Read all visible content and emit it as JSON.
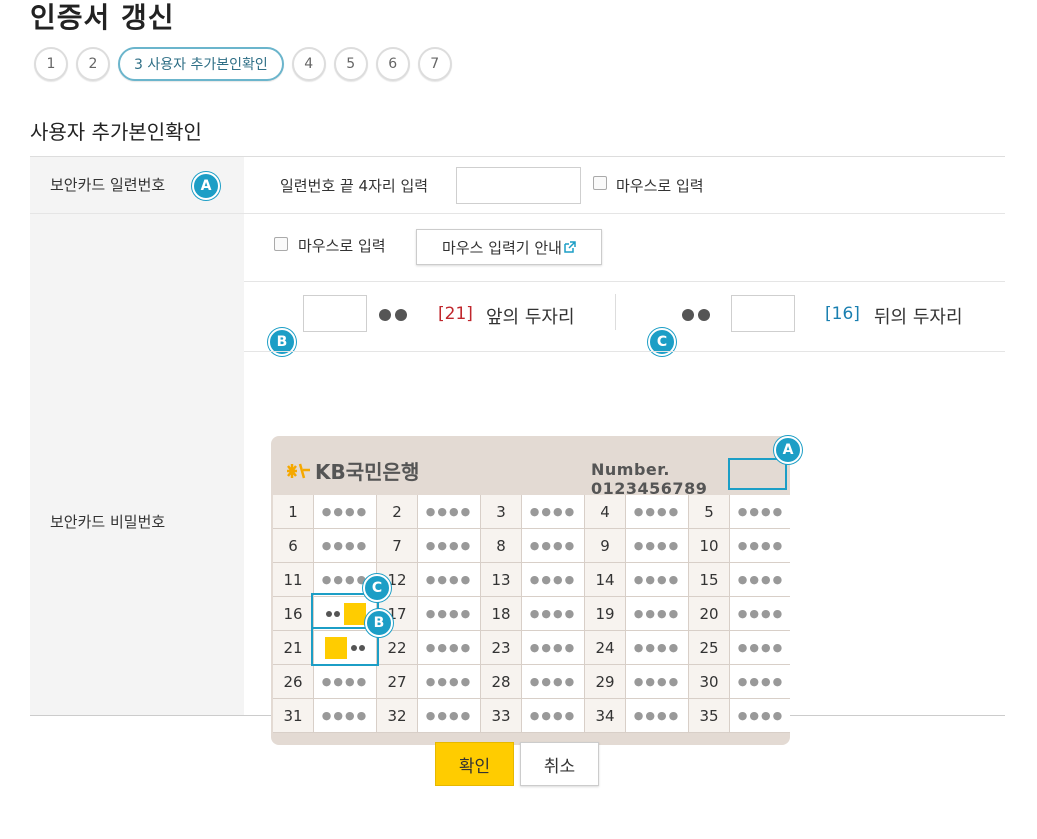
{
  "page": {
    "title": "인증서 갱신"
  },
  "steps": [
    {
      "label": "1"
    },
    {
      "label": "2"
    },
    {
      "label": "3 사용자 추가본인확인"
    },
    {
      "label": "4"
    },
    {
      "label": "5"
    },
    {
      "label": "6"
    },
    {
      "label": "7"
    }
  ],
  "section": {
    "title": "사용자 추가본인확인"
  },
  "serial": {
    "label": "보안카드 일련번호",
    "badge": "A",
    "prompt": "일련번호 끝 4자리 입력",
    "mouse_label": "마우스로 입력",
    "value": ""
  },
  "password": {
    "label": "보안카드 비밀번호",
    "mouse_label": "마우스로 입력",
    "guide_button": "마우스 입력기 안내",
    "b": {
      "badge": "B",
      "index_text": "[21]",
      "desc": "앞의 두자리",
      "value": ""
    },
    "c": {
      "badge": "C",
      "index_text": "[16]",
      "desc": "뒤의 두자리",
      "value": ""
    }
  },
  "card": {
    "bank": "KB국민은행",
    "number_label": "Number. 0123456789",
    "badge_a": "A",
    "badge_b": "B",
    "badge_c": "C",
    "masked": "●●●●",
    "numbers": [
      "1",
      "2",
      "3",
      "4",
      "5",
      "6",
      "7",
      "8",
      "9",
      "10",
      "11",
      "12",
      "13",
      "14",
      "15",
      "16",
      "17",
      "18",
      "19",
      "20",
      "21",
      "22",
      "23",
      "24",
      "25",
      "26",
      "27",
      "28",
      "29",
      "30",
      "31",
      "32",
      "33",
      "34",
      "35"
    ]
  },
  "buttons": {
    "confirm": "확인",
    "cancel": "취소"
  },
  "colors": {
    "accent": "#1c9ec6",
    "confirm": "#ffcc00",
    "red": "#c0272d",
    "blue": "#1a7fb0"
  }
}
